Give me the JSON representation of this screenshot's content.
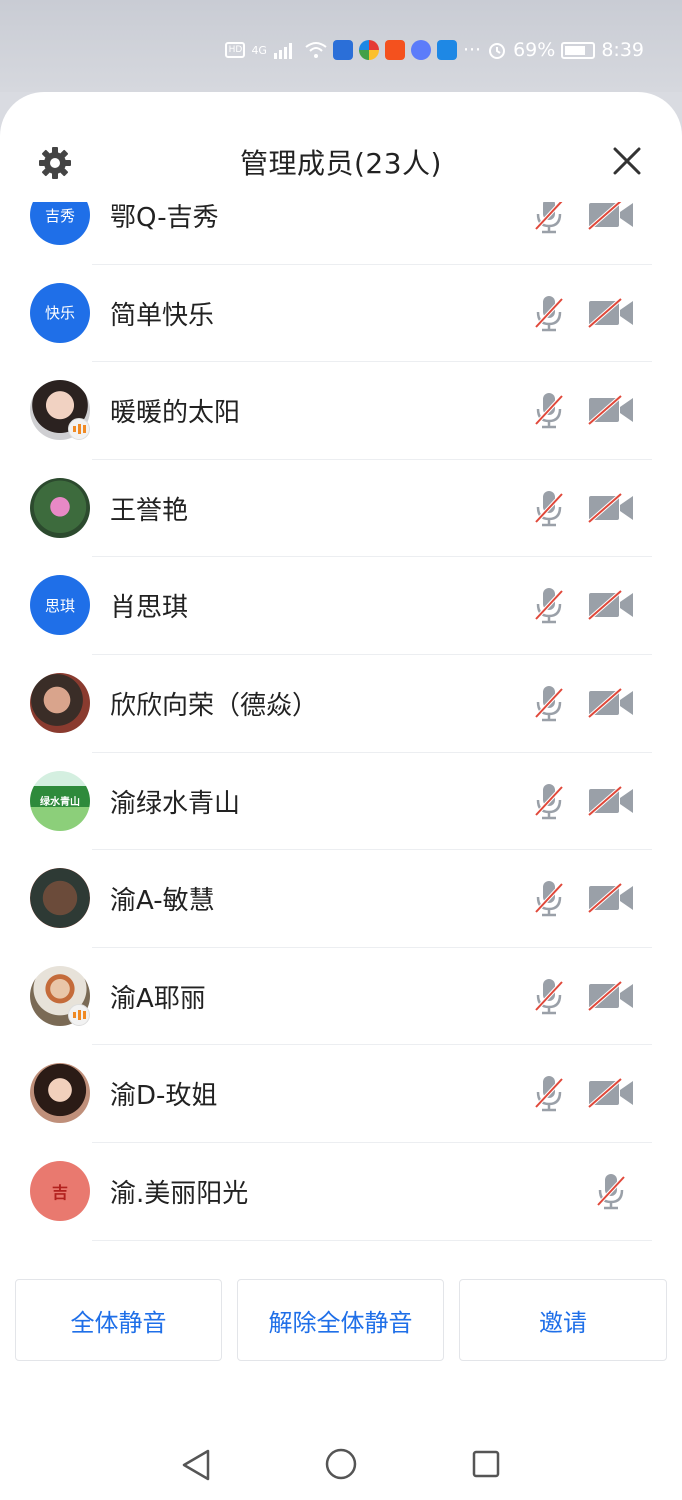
{
  "status_bar": {
    "battery": "69%",
    "time": "8:39",
    "hd_label": "HD",
    "network": "4G",
    "more": "···"
  },
  "header": {
    "title": "管理成员(23人)",
    "settings_icon": "gear-icon",
    "close_icon": "close-icon"
  },
  "members": [
    {
      "name": "鄂Q-吉秀",
      "avatar_text": "吉秀",
      "mic": "muted",
      "camera": "off"
    },
    {
      "name": "简单快乐",
      "avatar_text": "快乐",
      "mic": "muted",
      "camera": "off"
    },
    {
      "name": "暖暖的太阳",
      "avatar_text": "",
      "mic": "muted",
      "camera": "off",
      "speaking": true
    },
    {
      "name": "王誉艳",
      "avatar_text": "",
      "mic": "muted",
      "camera": "off"
    },
    {
      "name": "肖思琪",
      "avatar_text": "思琪",
      "mic": "muted",
      "camera": "off"
    },
    {
      "name": "欣欣向荣（德焱）",
      "avatar_text": "",
      "mic": "muted",
      "camera": "off"
    },
    {
      "name": "渝绿水青山",
      "avatar_text": "",
      "mic": "muted",
      "camera": "off"
    },
    {
      "name": "渝A-敏慧",
      "avatar_text": "",
      "mic": "muted",
      "camera": "off"
    },
    {
      "name": "渝A耶丽",
      "avatar_text": "",
      "mic": "muted",
      "camera": "off",
      "speaking": true
    },
    {
      "name": "渝D-玫姐",
      "avatar_text": "",
      "mic": "muted",
      "camera": "off"
    },
    {
      "name": "渝.美丽阳光",
      "avatar_text": "",
      "mic": "muted"
    }
  ],
  "actions": {
    "mute_all": "全体静音",
    "unmute_all": "解除全体静音",
    "invite": "邀请"
  },
  "colors": {
    "accent": "#1f6fe8",
    "muted_slash": "#e0483a"
  }
}
